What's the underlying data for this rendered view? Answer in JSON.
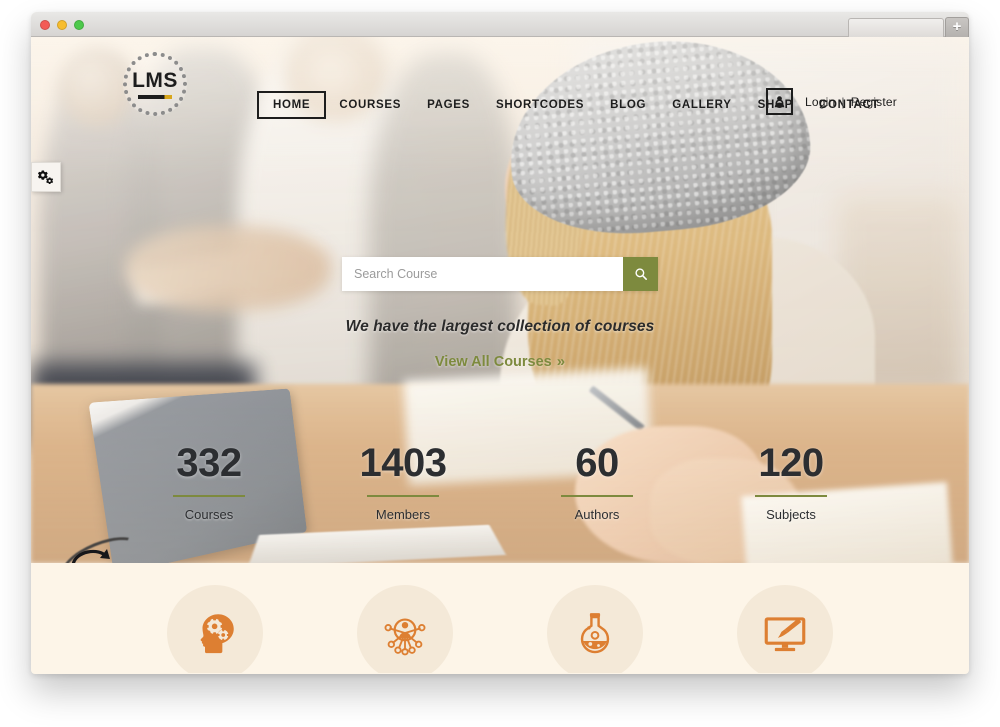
{
  "browser": {
    "traffic_lights": [
      "close",
      "minimize",
      "maximize"
    ],
    "new_tab_label": "+",
    "colors": {
      "close": "#f35b56",
      "minimize": "#f7bd2e",
      "maximize": "#4dc94b"
    }
  },
  "site": {
    "logo": {
      "text": "LMS",
      "icon": "lms-logo-icon"
    },
    "nav": [
      {
        "label": "HOME",
        "active": true
      },
      {
        "label": "COURSES",
        "active": false
      },
      {
        "label": "PAGES",
        "active": false
      },
      {
        "label": "SHORTCODES",
        "active": false
      },
      {
        "label": "BLOG",
        "active": false
      },
      {
        "label": "GALLERY",
        "active": false
      },
      {
        "label": "SHOP",
        "active": false
      },
      {
        "label": "CONTACT",
        "active": false
      }
    ],
    "account": {
      "user_icon": "user-icon",
      "login_label": "Login",
      "separator": "|",
      "register_label": "Register"
    },
    "settings_tab": {
      "icon": "gears-settings-icon"
    }
  },
  "hero": {
    "search": {
      "placeholder": "Search Course",
      "value": "",
      "button_icon": "search-icon",
      "button_color": "#7d8a3e"
    },
    "tagline": "We have the largest collection of courses",
    "cta": {
      "label": "View All Courses",
      "chevron": "»",
      "color": "#7d8a3e"
    },
    "counters": [
      {
        "value": "332",
        "label": "Courses"
      },
      {
        "value": "1403",
        "label": "Members"
      },
      {
        "value": "60",
        "label": "Authors"
      },
      {
        "value": "120",
        "label": "Subjects"
      }
    ],
    "loop_arrow_icon": "loop-arrow-icon"
  },
  "features": {
    "background": "#fdf5e8",
    "circle_color": "#f4e9d8",
    "icon_color": "#dd7f32",
    "items": [
      {
        "icon": "head-gears-icon"
      },
      {
        "icon": "people-network-icon"
      },
      {
        "icon": "flask-icon"
      },
      {
        "icon": "monitor-brush-icon"
      }
    ]
  }
}
